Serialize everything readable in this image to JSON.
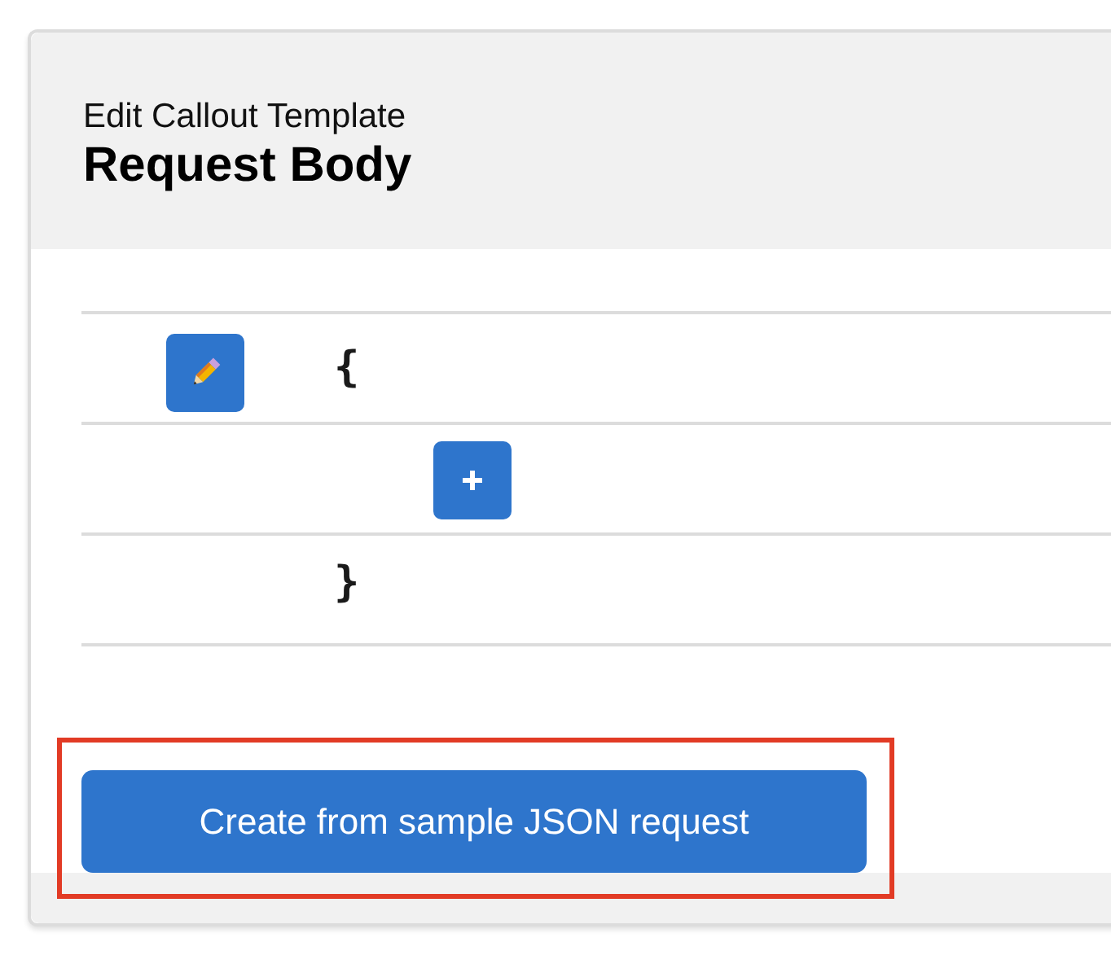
{
  "header": {
    "subtitle": "Edit Callout Template",
    "title": "Request Body"
  },
  "rows": [
    {
      "kind": "edit",
      "text": "{"
    },
    {
      "kind": "add"
    },
    {
      "kind": "close",
      "text": "}"
    }
  ],
  "action_button": {
    "label": "Create from sample JSON request",
    "highlighted": true
  }
}
